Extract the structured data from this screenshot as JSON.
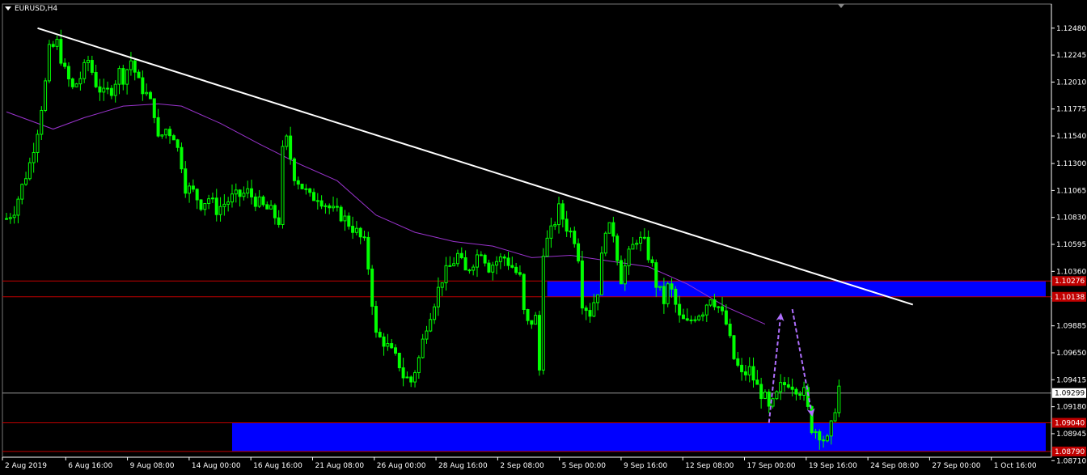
{
  "chart_data": {
    "type": "candlestick",
    "title": "EURUSD,H4",
    "symbol": "EURUSD",
    "timeframe": "H4",
    "ylim": [
      1.0874,
      1.1269
    ],
    "y_ticks": [
      1.1248,
      1.12245,
      1.1201,
      1.11775,
      1.1154,
      1.113,
      1.11065,
      1.1083,
      1.10595,
      1.1036,
      1.10125,
      1.09885,
      1.0965,
      1.09415,
      1.0918,
      1.08945,
      1.0871
    ],
    "y_tick_labels": [
      "1.12480",
      "1.12245",
      "1.12010",
      "1.11775",
      "1.11540",
      "1.11300",
      "1.11065",
      "1.10830",
      "1.10595",
      "1.10360",
      "1.10125",
      "1.09885",
      "1.09650",
      "1.09415",
      "1.09180",
      "1.08945",
      "1.08710"
    ],
    "x_tick_labels": [
      "2 Aug 2019",
      "6 Aug 16:00",
      "9 Aug 08:00",
      "14 Aug 00:00",
      "16 Aug 16:00",
      "21 Aug 08:00",
      "26 Aug 00:00",
      "28 Aug 16:00",
      "2 Sep 08:00",
      "5 Sep 00:00",
      "9 Sep 16:00",
      "12 Sep 08:00",
      "17 Sep 00:00",
      "19 Sep 16:00",
      "24 Sep 08:00",
      "27 Sep 00:00",
      "1 Oct 16:00"
    ],
    "price_path": [
      [
        0,
        1.1082
      ],
      [
        2,
        1.109
      ],
      [
        4,
        1.111
      ],
      [
        6,
        1.113
      ],
      [
        8,
        1.116
      ],
      [
        10,
        1.12
      ],
      [
        11,
        1.1228
      ],
      [
        13,
        1.1235
      ],
      [
        15,
        1.121
      ],
      [
        17,
        1.1195
      ],
      [
        19,
        1.1205
      ],
      [
        21,
        1.122
      ],
      [
        23,
        1.12
      ],
      [
        25,
        1.119
      ],
      [
        27,
        1.1195
      ],
      [
        29,
        1.121
      ],
      [
        30,
        1.1205
      ],
      [
        32,
        1.122
      ],
      [
        34,
        1.12
      ],
      [
        36,
        1.119
      ],
      [
        38,
        1.1175
      ],
      [
        39,
        1.115
      ],
      [
        41,
        1.116
      ],
      [
        43,
        1.1155
      ],
      [
        45,
        1.113
      ],
      [
        46,
        1.111
      ],
      [
        48,
        1.1105
      ],
      [
        50,
        1.1095
      ],
      [
        52,
        1.11
      ],
      [
        54,
        1.109
      ],
      [
        56,
        1.1095
      ],
      [
        58,
        1.11
      ],
      [
        60,
        1.1102
      ],
      [
        62,
        1.1105
      ],
      [
        64,
        1.1098
      ],
      [
        66,
        1.1092
      ],
      [
        68,
        1.1088
      ],
      [
        70,
        1.108
      ],
      [
        71,
        1.114
      ],
      [
        72,
        1.115
      ],
      [
        74,
        1.112
      ],
      [
        76,
        1.111
      ],
      [
        78,
        1.11
      ],
      [
        80,
        1.1102
      ],
      [
        82,
        1.1095
      ],
      [
        84,
        1.1088
      ],
      [
        86,
        1.1085
      ],
      [
        88,
        1.1078
      ],
      [
        90,
        1.107
      ],
      [
        92,
        1.106
      ],
      [
        93,
        1.104
      ],
      [
        95,
        1.098
      ],
      [
        97,
        1.0975
      ],
      [
        99,
        1.0965
      ],
      [
        101,
        1.0955
      ],
      [
        102,
        1.0945
      ],
      [
        104,
        1.094
      ],
      [
        106,
        1.096
      ],
      [
        108,
        1.099
      ],
      [
        110,
        1.101
      ],
      [
        112,
        1.103
      ],
      [
        114,
        1.104
      ],
      [
        116,
        1.105
      ],
      [
        118,
        1.1035
      ],
      [
        120,
        1.1045
      ],
      [
        122,
        1.1055
      ],
      [
        124,
        1.104
      ],
      [
        126,
        1.1045
      ],
      [
        128,
        1.1048
      ],
      [
        130,
        1.104
      ],
      [
        132,
        1.103
      ],
      [
        133,
        1.1
      ],
      [
        134,
        1.099
      ],
      [
        136,
        1.0995
      ],
      [
        137,
        1.095
      ],
      [
        138,
        1.1055
      ],
      [
        140,
        1.107
      ],
      [
        142,
        1.109
      ],
      [
        144,
        1.1075
      ],
      [
        146,
        1.1065
      ],
      [
        147,
        1.105
      ],
      [
        148,
        1.101
      ],
      [
        150,
        1.1
      ],
      [
        152,
        1.102
      ],
      [
        154,
        1.1075
      ],
      [
        156,
        1.107
      ],
      [
        158,
        1.103
      ],
      [
        160,
        1.105
      ],
      [
        162,
        1.1065
      ],
      [
        164,
        1.106
      ],
      [
        166,
        1.104
      ],
      [
        167,
        1.1025
      ],
      [
        169,
        1.101
      ],
      [
        170,
        1.1022
      ],
      [
        171,
        1.1018
      ],
      [
        173,
        1.0995
      ],
      [
        175,
        1.099
      ],
      [
        177,
        1.0998
      ],
      [
        179,
        1.1002
      ],
      [
        181,
        1.1015
      ],
      [
        183,
        1.1005
      ],
      [
        185,
        1.099
      ],
      [
        187,
        1.096
      ],
      [
        189,
        1.0945
      ],
      [
        191,
        1.095
      ],
      [
        193,
        1.0935
      ],
      [
        195,
        1.0925
      ],
      [
        196,
        1.0915
      ],
      [
        197,
        1.092
      ],
      [
        199,
        1.0935
      ],
      [
        201,
        1.094
      ],
      [
        203,
        1.0935
      ],
      [
        205,
        1.093
      ],
      [
        207,
        1.09
      ],
      [
        209,
        1.0895
      ],
      [
        210,
        1.089
      ],
      [
        211,
        1.0888
      ],
      [
        212,
        1.09
      ],
      [
        213,
        1.0918
      ],
      [
        214,
        1.0935
      ]
    ],
    "moving_average": [
      [
        0,
        1.1175
      ],
      [
        12,
        1.116
      ],
      [
        20,
        1.117
      ],
      [
        30,
        1.118
      ],
      [
        39,
        1.1182
      ],
      [
        45,
        1.118
      ],
      [
        55,
        1.1165
      ],
      [
        65,
        1.1147
      ],
      [
        75,
        1.113
      ],
      [
        85,
        1.1115
      ],
      [
        95,
        1.1085
      ],
      [
        105,
        1.107
      ],
      [
        115,
        1.1062
      ],
      [
        125,
        1.1058
      ],
      [
        135,
        1.1048
      ],
      [
        145,
        1.105
      ],
      [
        155,
        1.1045
      ],
      [
        165,
        1.104
      ],
      [
        175,
        1.1025
      ],
      [
        185,
        1.1005
      ],
      [
        195,
        1.099
      ]
    ],
    "trendline": [
      [
        8,
        1.1248
      ],
      [
        233,
        1.1007
      ]
    ],
    "horizontal_lines": [
      1.10276,
      1.10138,
      1.09299,
      1.0904,
      1.0879
    ],
    "price_labels": [
      {
        "value": 1.10276,
        "text": "1.10276",
        "color": "#c00000"
      },
      {
        "value": 1.10138,
        "text": "1.10138",
        "color": "#c00000"
      },
      {
        "value": 1.09299,
        "text": "1.09299",
        "color": "#000000"
      },
      {
        "value": 1.0904,
        "text": "1.09040",
        "color": "#c00000"
      },
      {
        "value": 1.0879,
        "text": "1.08790",
        "color": "#c00000"
      }
    ],
    "zones": [
      {
        "from": 1.10138,
        "to": 1.10276,
        "x_start": 139,
        "color": "#0000ff"
      },
      {
        "from": 1.0879,
        "to": 1.0904,
        "x_start": 58,
        "color": "#0000ff"
      }
    ],
    "arrows": [
      {
        "from": [
          196,
          1.0904
        ],
        "to": [
          199,
          1.0997
        ]
      },
      {
        "from": [
          202,
          1.1003
        ],
        "to": [
          207,
          1.0912
        ]
      }
    ],
    "colors": {
      "background": "#000000",
      "candles": "#00ff00",
      "moving_average": "#9933cc",
      "trendline": "#ffffff",
      "level_line": "#c00000",
      "zone": "#0000ff",
      "arrow": "#b06fff",
      "text": "#ffffff"
    },
    "grid": false,
    "legend": "none"
  }
}
